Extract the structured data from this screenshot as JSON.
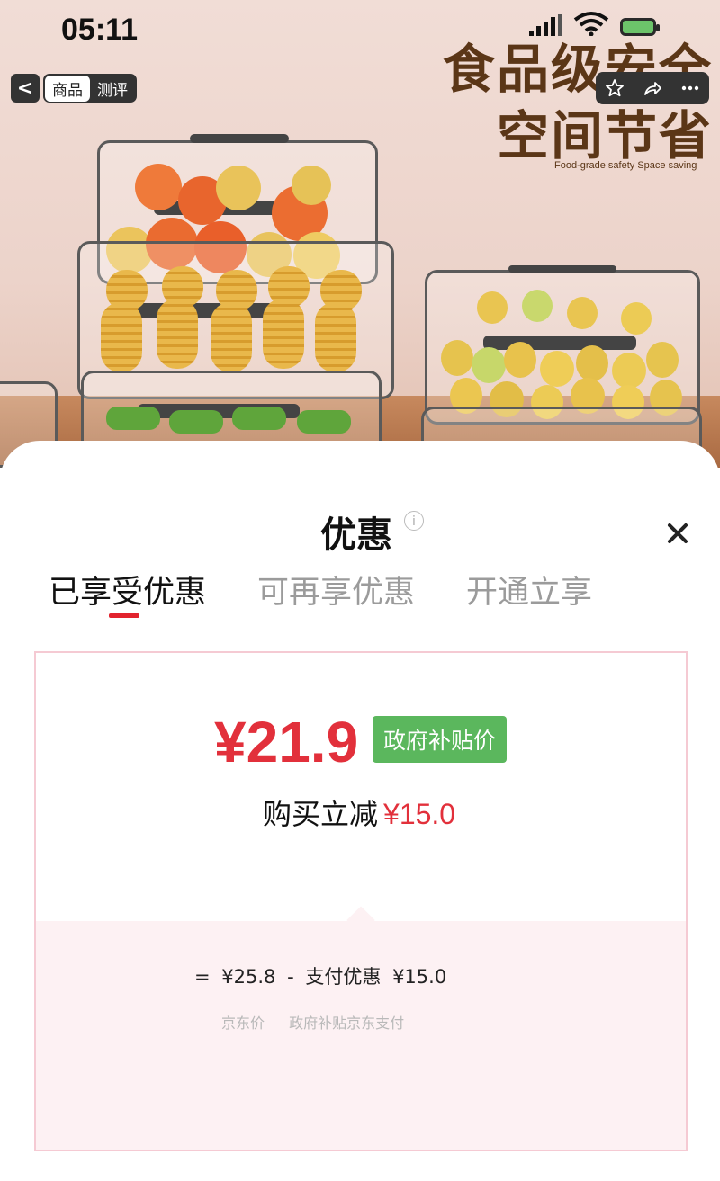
{
  "status_bar": {
    "time": "05:11"
  },
  "top_nav": {
    "back_label": "<",
    "tab_product": "商品",
    "tab_review": "测评"
  },
  "hero": {
    "slogan_line1": "食品级安全",
    "slogan_line2": "空间节省",
    "slogan_en": "Food-grade safety Space saving"
  },
  "sheet": {
    "title": "优惠",
    "tabs": [
      {
        "label": "已享受优惠",
        "active": true
      },
      {
        "label": "可再享优惠",
        "active": false
      },
      {
        "label": "开通立享",
        "active": false
      }
    ],
    "price": "¥21.9",
    "price_badge": "政府补贴价",
    "reduce_label": "购买立减",
    "reduce_amount": "¥15.0",
    "formula": {
      "equals": "=",
      "base_price": "¥25.8",
      "minus": "-",
      "discount_label": "支付优惠",
      "discount_value": "¥15.0"
    },
    "formula_labels": {
      "base_label": "京东价",
      "discount_desc": "政府补贴京东支付"
    }
  },
  "colors": {
    "accent_red": "#e2303b",
    "badge_green": "#5bb75d",
    "card_border": "#f5cad3",
    "card_lower_bg": "#fdf1f3"
  }
}
